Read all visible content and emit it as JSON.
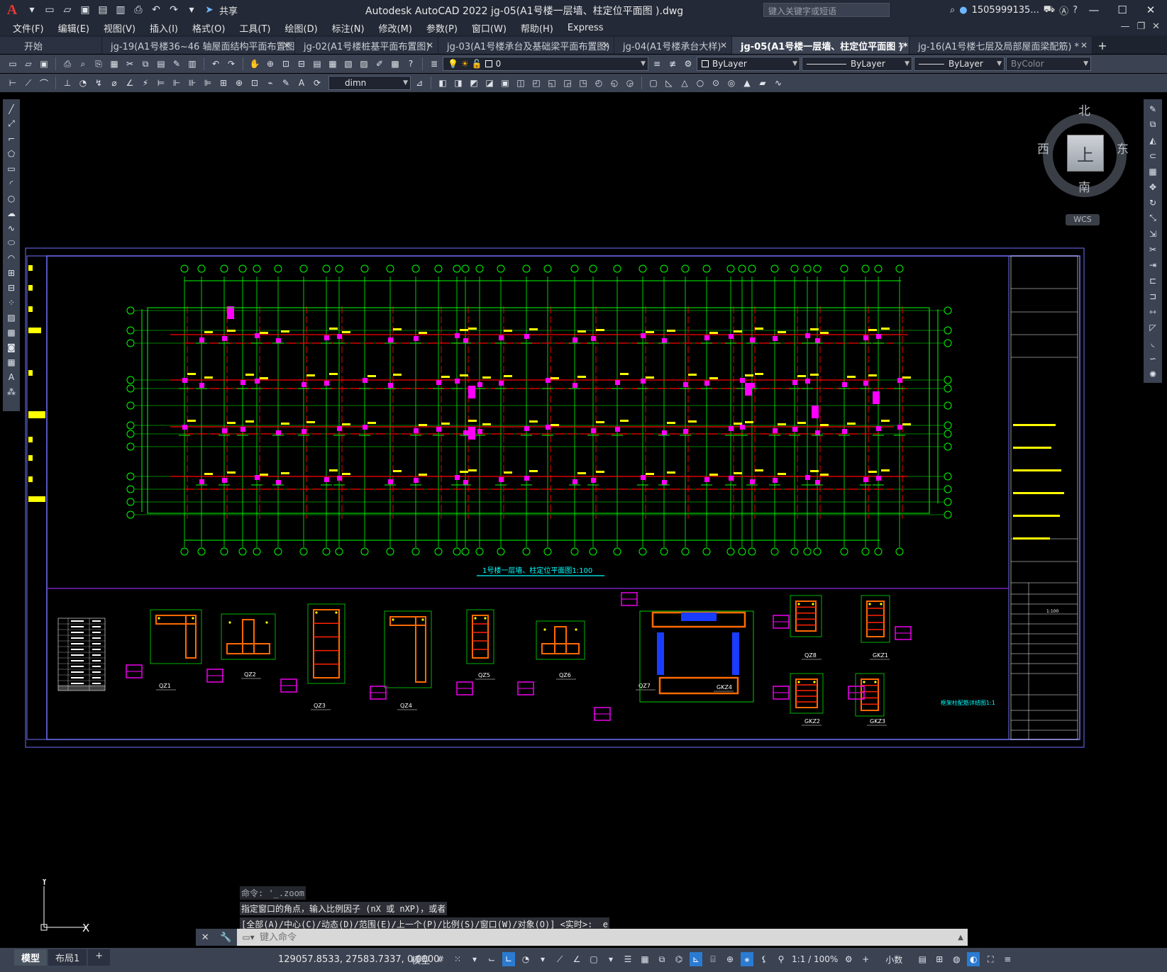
{
  "app": {
    "logo": "A",
    "share_label": "共享",
    "title": "Autodesk AutoCAD 2022    jg-05(A1号楼一层墙、柱定位平面图 ).dwg",
    "search_placeholder": "键入关键字或短语",
    "user": "1505999135...",
    "window_controls": [
      "—",
      "☐",
      "✕"
    ]
  },
  "menu": [
    "文件(F)",
    "编辑(E)",
    "视图(V)",
    "插入(I)",
    "格式(O)",
    "工具(T)",
    "绘图(D)",
    "标注(N)",
    "修改(M)",
    "参数(P)",
    "窗口(W)",
    "帮助(H)",
    "Express"
  ],
  "file_tabs": [
    {
      "label": "开始",
      "closable": false
    },
    {
      "label": "jg-19(A1号楼36~46 轴屋面结构平面布置图)",
      "closable": true
    },
    {
      "label": "jg-02(A1号楼桩基平面布置图)",
      "closable": true
    },
    {
      "label": "jg-03(A1号楼承台及基础梁平面布置图)",
      "closable": true
    },
    {
      "label": "jg-04(A1号楼承台大样)",
      "closable": true
    },
    {
      "label": "jg-05(A1号楼一层墙、柱定位平面图 )*",
      "closable": true,
      "active": true
    },
    {
      "label": "jg-16(A1号楼七层及局部屋面梁配筋) *",
      "closable": true
    }
  ],
  "toolbar1": {
    "layer_value": "0",
    "color_value": "ByLayer",
    "linetype_value": "ByLayer",
    "lineweight_value": "ByLayer",
    "plotstyle_value": "ByColor"
  },
  "toolbar2": {
    "dimstyle_value": "dimn"
  },
  "viewcube": {
    "north": "北",
    "south": "南",
    "east": "东",
    "west": "西",
    "face": "上",
    "wcs": "WCS"
  },
  "drawing": {
    "plan_title": "1号楼一层墙、柱定位平面图1:100",
    "detail_title": "框架柱配筋详结图1:1",
    "scale_note": "1:100",
    "column_labels": [
      "QZ1",
      "QZ2",
      "QZ3",
      "QZ4",
      "QZ5",
      "QZ6",
      "QZ7",
      "QZ8",
      "GKZ1",
      "GKZ2",
      "GKZ3",
      "GKZ4"
    ]
  },
  "ucs": {
    "x": "X",
    "y": "Y"
  },
  "command": {
    "history": [
      "命令: '_.zoom",
      "指定窗口的角点，输入比例因子 (nX 或 nXP)，或者",
      "[全部(A)/中心(C)/动态(D)/范围(E)/上一个(P)/比例(S)/窗口(W)/对象(O)] <实时>: _e"
    ],
    "placeholder": "键入命令"
  },
  "status": {
    "layout_tabs": [
      "模型",
      "布局1"
    ],
    "coords": "129057.8533, 27583.7337, 0.0000",
    "mode": "模型",
    "scale": "1:1 / 100%",
    "units": "小数"
  },
  "colors": {
    "chrome_dark": "#232936",
    "toolbar": "#3b4252",
    "grid_green": "#00ff00",
    "axis_red": "#ff0000",
    "column_magenta": "#ff00ff",
    "frame_blue": "#7070ff",
    "text_yellow": "#ffff00",
    "title_cyan": "#00ffff"
  }
}
